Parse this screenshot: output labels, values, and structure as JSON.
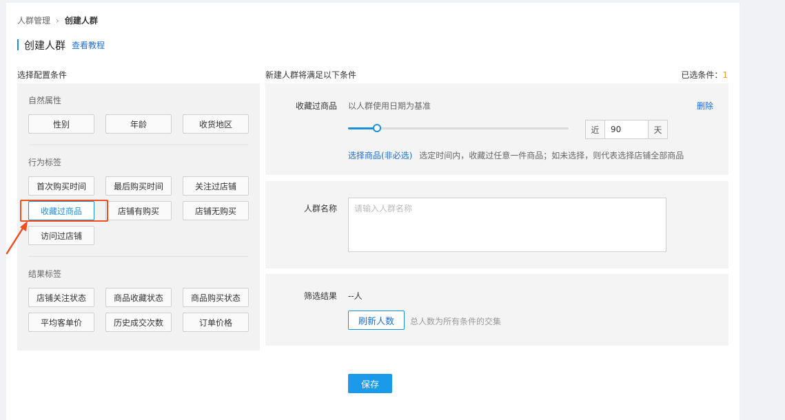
{
  "breadcrumb": {
    "parent": "人群管理",
    "separator": "›",
    "current": "创建人群"
  },
  "page": {
    "title": "创建人群",
    "tutorial_link": "查看教程"
  },
  "left": {
    "heading": "选择配置条件",
    "sections": [
      {
        "title": "自然属性",
        "tags": [
          "性别",
          "年龄",
          "收货地区"
        ]
      },
      {
        "title": "行为标签",
        "tags": [
          "首次购买时间",
          "最后购买时间",
          "关注过店铺",
          "收藏过商品",
          "店铺有购买",
          "店铺无购买",
          "访问过店铺"
        ]
      },
      {
        "title": "结果标签",
        "tags": [
          "店铺关注状态",
          "商品收藏状态",
          "商品购买状态",
          "平均客单价",
          "历史成交次数",
          "订单价格"
        ]
      }
    ],
    "active_tag": "收藏过商品"
  },
  "right": {
    "heading": "新建人群将满足以下条件",
    "selected_label": "已选条件：",
    "selected_count": "1",
    "condition": {
      "label": "收藏过商品",
      "basis": "以人群使用日期为基准",
      "delete": "删除",
      "slider_fraction": 0.13,
      "days_prefix": "近",
      "days_value": "90",
      "days_suffix": "天",
      "select_link": "选择商品(非必选)",
      "hint": "选定时间内，收藏过任意一件商品；如未选择，则代表选择店铺全部商品"
    },
    "name_field": {
      "label": "人群名称",
      "placeholder": "请输入人群名称",
      "value": ""
    },
    "result": {
      "label": "筛选结果",
      "value": "--人",
      "refresh": "刷新人数",
      "note": "总人数为所有条件的交集"
    }
  },
  "footer": {
    "save": "保存"
  },
  "colors": {
    "accent": "#1a8fe0",
    "highlight": "#f04e1e",
    "count": "#f29a1c"
  }
}
